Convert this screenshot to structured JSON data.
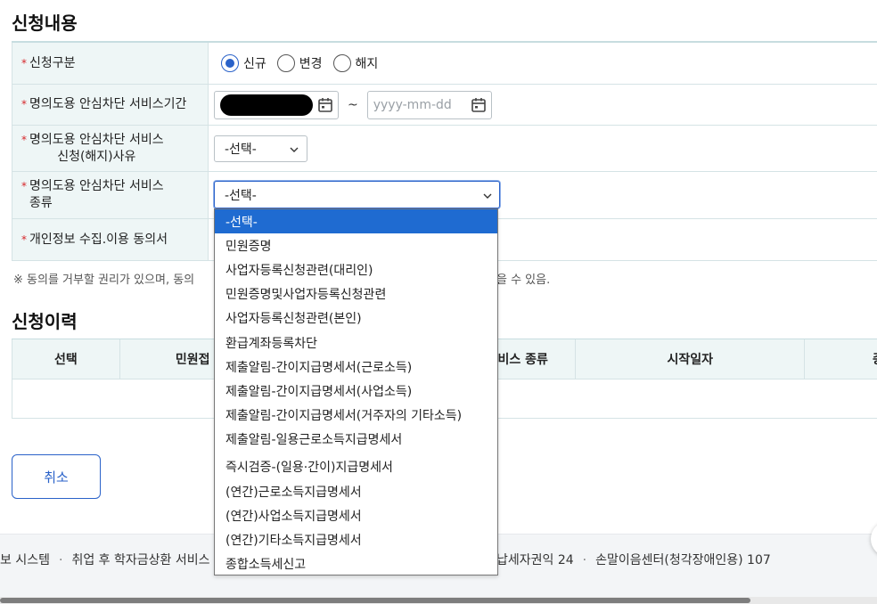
{
  "sections": {
    "apply_title": "신청내용",
    "history_title": "신청이력"
  },
  "form": {
    "category": {
      "label": "신청구분",
      "options": [
        {
          "label": "신규",
          "checked": true
        },
        {
          "label": "변경",
          "checked": false
        },
        {
          "label": "해지",
          "checked": false
        }
      ]
    },
    "period": {
      "label": "명의도용 안심차단 서비스기간",
      "separator": "~",
      "end_placeholder": "yyyy-mm-dd"
    },
    "reason": {
      "label": "명의도용 안심차단 서비스\n신청(해지)사유",
      "selected": "-선택-"
    },
    "service_type": {
      "label": "명의도용 안심차단 서비스\n종류",
      "selected": "-선택-"
    },
    "consent": {
      "label": "개인정보 수집.이용 동의서"
    },
    "required_mark": "*"
  },
  "notice": {
    "left": "※ 동의를 거부할 권리가 있으며, 동의",
    "right": "을 수 있음."
  },
  "history_table": {
    "headers": [
      "선택",
      "민원접",
      "비스 종류",
      "시작일자",
      "종"
    ]
  },
  "buttons": {
    "cancel": "취소"
  },
  "footer": {
    "left_items": [
      "보 시스템",
      "취업 후 학자금상환 서비스"
    ],
    "right_items": [
      "납세자권익 24",
      "손말이음센터(청각장애인용) 107"
    ]
  },
  "dropdown": {
    "items": [
      "-선택-",
      "민원증명",
      "사업자등록신청관련(대리인)",
      "민원증명및사업자등록신청관련",
      "사업자등록신청관련(본인)",
      "환급계좌등록차단",
      "제출알림-간이지급명세서(근로소득)",
      "제출알림-간이지급명세서(사업소득)",
      "제출알림-간이지급명세서(거주자의 기타소득)",
      "제출알림-일용근로소득지급명세서",
      "즉시검증-(일용·간이)지급명세서",
      "(연간)근로소득지급명세서",
      "(연간)사업소득지급명세서",
      "(연간)기타소득지급명세서",
      "종합소득세신고"
    ],
    "selected_index": 0
  },
  "colors": {
    "accent": "#2a62c9",
    "required": "#d6262a",
    "label_bg": "#eef6f6",
    "dropdown_highlight": "#1f6bd1"
  }
}
